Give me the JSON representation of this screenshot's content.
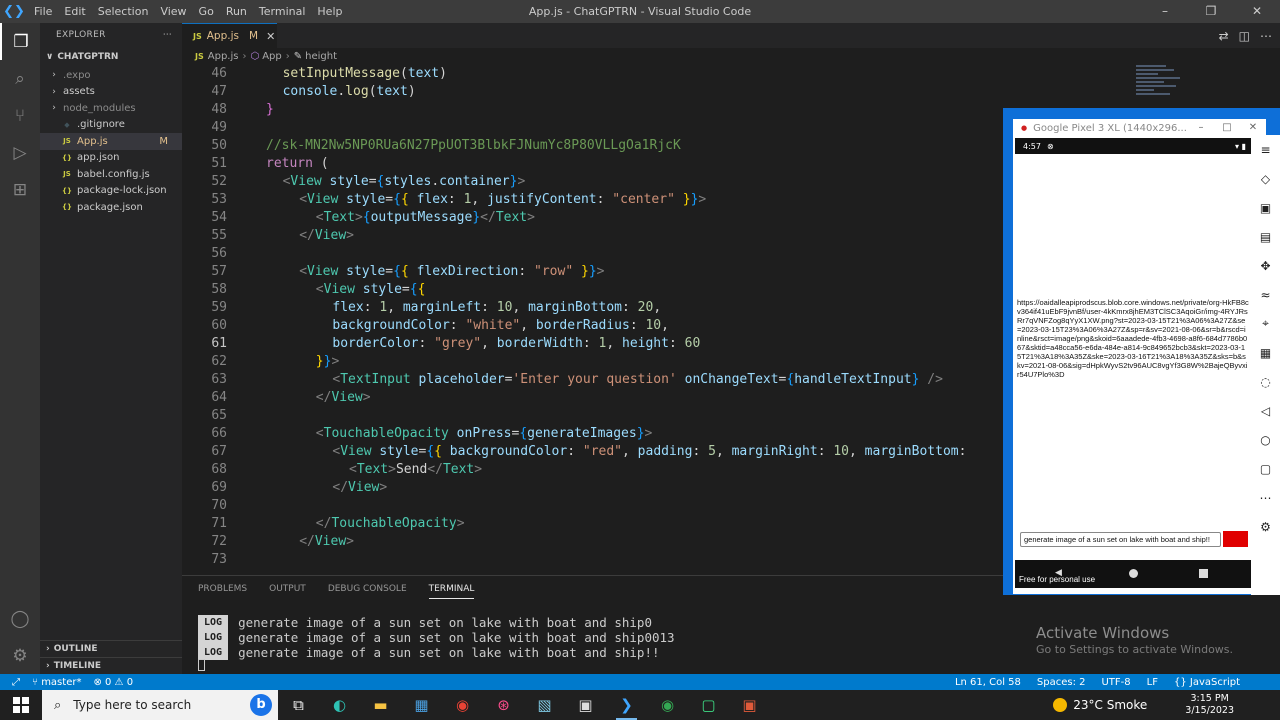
{
  "window": {
    "title": "App.js - ChatGPTRN - Visual Studio Code",
    "menu": [
      "File",
      "Edit",
      "Selection",
      "View",
      "Go",
      "Run",
      "Terminal",
      "Help"
    ]
  },
  "sidebar": {
    "header": "EXPLORER",
    "folder": "CHATGPTRN",
    "items": [
      {
        "label": ".expo",
        "type": "folder",
        "dim": true
      },
      {
        "label": "assets",
        "type": "folder",
        "dim": false
      },
      {
        "label": "node_modules",
        "type": "folder",
        "dim": true
      },
      {
        "label": ".gitignore",
        "type": "git",
        "dim": false
      },
      {
        "label": "App.js",
        "type": "js",
        "badge": "M"
      },
      {
        "label": "app.json",
        "type": "json"
      },
      {
        "label": "babel.config.js",
        "type": "js"
      },
      {
        "label": "package-lock.json",
        "type": "json"
      },
      {
        "label": "package.json",
        "type": "json"
      }
    ],
    "outline": "OUTLINE",
    "timeline": "TIMELINE"
  },
  "tabs": [
    {
      "label": "App.js",
      "badge": "M"
    }
  ],
  "breadcrumbs": [
    "App.js",
    "App",
    "height"
  ],
  "code_lines": [
    {
      "n": "46",
      "tokens": [
        [
          "fn",
          "setInputMessage"
        ],
        [
          "p",
          "("
        ],
        [
          "var",
          "text"
        ],
        [
          "p",
          ")"
        ]
      ]
    },
    {
      "n": "47",
      "tokens": [
        [
          "var",
          "console"
        ],
        [
          "p",
          "."
        ],
        [
          "fn",
          "log"
        ],
        [
          "p",
          "("
        ],
        [
          "var",
          "text"
        ],
        [
          "p",
          ")"
        ]
      ]
    },
    {
      "n": "48",
      "tokens": [
        [
          "br2",
          "}"
        ]
      ]
    },
    {
      "n": "49",
      "tokens": []
    },
    {
      "n": "50",
      "tokens": [
        [
          "cm",
          "//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"
        ]
      ]
    },
    {
      "n": "51",
      "tokens": [
        [
          "kw",
          "return"
        ],
        [
          "p",
          " ("
        ]
      ]
    },
    {
      "n": "52",
      "tokens": [
        [
          "punc",
          "<"
        ],
        [
          "tag",
          "View"
        ],
        [
          "var",
          " style"
        ],
        [
          "p",
          "="
        ],
        [
          "br3",
          "{"
        ],
        [
          "var",
          "styles"
        ],
        [
          "p",
          "."
        ],
        [
          "var",
          "container"
        ],
        [
          "br3",
          "}"
        ],
        [
          "punc",
          ">"
        ]
      ]
    },
    {
      "n": "53",
      "tokens": [
        [
          "punc",
          "<"
        ],
        [
          "tag",
          "View"
        ],
        [
          "var",
          " style"
        ],
        [
          "p",
          "="
        ],
        [
          "br3",
          "{"
        ],
        [
          "br",
          "{"
        ],
        [
          "var",
          " flex"
        ],
        [
          "p",
          ": "
        ],
        [
          "num",
          "1"
        ],
        [
          "p",
          ", "
        ],
        [
          "var",
          "justifyContent"
        ],
        [
          "p",
          ": "
        ],
        [
          "str",
          "\"center\""
        ],
        [
          "p",
          " "
        ],
        [
          "br",
          "}"
        ],
        [
          "br3",
          "}"
        ],
        [
          "punc",
          ">"
        ]
      ]
    },
    {
      "n": "54",
      "tokens": [
        [
          "punc",
          "<"
        ],
        [
          "tag",
          "Text"
        ],
        [
          "punc",
          ">"
        ],
        [
          "br3",
          "{"
        ],
        [
          "var",
          "outputMessage"
        ],
        [
          "br3",
          "}"
        ],
        [
          "punc",
          "</"
        ],
        [
          "tag",
          "Text"
        ],
        [
          "punc",
          ">"
        ]
      ]
    },
    {
      "n": "55",
      "tokens": [
        [
          "punc",
          "</"
        ],
        [
          "tag",
          "View"
        ],
        [
          "punc",
          ">"
        ]
      ]
    },
    {
      "n": "56",
      "tokens": []
    },
    {
      "n": "57",
      "tokens": [
        [
          "punc",
          "<"
        ],
        [
          "tag",
          "View"
        ],
        [
          "var",
          " style"
        ],
        [
          "p",
          "="
        ],
        [
          "br3",
          "{"
        ],
        [
          "br",
          "{"
        ],
        [
          "var",
          " flexDirection"
        ],
        [
          "p",
          ": "
        ],
        [
          "str",
          "\"row\""
        ],
        [
          "p",
          " "
        ],
        [
          "br",
          "}"
        ],
        [
          "br3",
          "}"
        ],
        [
          "punc",
          ">"
        ]
      ]
    },
    {
      "n": "58",
      "tokens": [
        [
          "punc",
          "<"
        ],
        [
          "tag",
          "View"
        ],
        [
          "var",
          " style"
        ],
        [
          "p",
          "="
        ],
        [
          "br3",
          "{"
        ],
        [
          "br",
          "{"
        ]
      ]
    },
    {
      "n": "59",
      "tokens": [
        [
          "var",
          "flex"
        ],
        [
          "p",
          ": "
        ],
        [
          "num",
          "1"
        ],
        [
          "p",
          ", "
        ],
        [
          "var",
          "marginLeft"
        ],
        [
          "p",
          ": "
        ],
        [
          "num",
          "10"
        ],
        [
          "p",
          ", "
        ],
        [
          "var",
          "marginBottom"
        ],
        [
          "p",
          ": "
        ],
        [
          "num",
          "20"
        ],
        [
          "p",
          ","
        ]
      ]
    },
    {
      "n": "60",
      "tokens": [
        [
          "var",
          "backgroundColor"
        ],
        [
          "p",
          ": "
        ],
        [
          "str",
          "\"white\""
        ],
        [
          "p",
          ", "
        ],
        [
          "var",
          "borderRadius"
        ],
        [
          "p",
          ": "
        ],
        [
          "num",
          "10"
        ],
        [
          "p",
          ","
        ]
      ]
    },
    {
      "n": "61",
      "tokens": [
        [
          "var",
          "borderColor"
        ],
        [
          "p",
          ": "
        ],
        [
          "str",
          "\"grey\""
        ],
        [
          "p",
          ", "
        ],
        [
          "var",
          "borderWidth"
        ],
        [
          "p",
          ": "
        ],
        [
          "num",
          "1"
        ],
        [
          "p",
          ", "
        ],
        [
          "var",
          "height"
        ],
        [
          "p",
          ": "
        ],
        [
          "num",
          "60"
        ]
      ]
    },
    {
      "n": "62",
      "tokens": [
        [
          "br",
          "}"
        ],
        [
          "br3",
          "}"
        ],
        [
          "punc",
          ">"
        ]
      ]
    },
    {
      "n": "63",
      "tokens": [
        [
          "punc",
          "<"
        ],
        [
          "tag",
          "TextInput"
        ],
        [
          "var",
          " placeholder"
        ],
        [
          "p",
          "="
        ],
        [
          "str",
          "'Enter your question'"
        ],
        [
          "var",
          " onChangeText"
        ],
        [
          "p",
          "="
        ],
        [
          "br3",
          "{"
        ],
        [
          "var",
          "handleTextInput"
        ],
        [
          "br3",
          "}"
        ],
        [
          "punc",
          " />"
        ]
      ]
    },
    {
      "n": "64",
      "tokens": [
        [
          "punc",
          "</"
        ],
        [
          "tag",
          "View"
        ],
        [
          "punc",
          ">"
        ]
      ]
    },
    {
      "n": "65",
      "tokens": []
    },
    {
      "n": "66",
      "tokens": [
        [
          "punc",
          "<"
        ],
        [
          "tag",
          "TouchableOpacity"
        ],
        [
          "var",
          " onPress"
        ],
        [
          "p",
          "="
        ],
        [
          "br3",
          "{"
        ],
        [
          "var",
          "generateImages"
        ],
        [
          "br3",
          "}"
        ],
        [
          "punc",
          ">"
        ]
      ]
    },
    {
      "n": "67",
      "tokens": [
        [
          "punc",
          "<"
        ],
        [
          "tag",
          "View"
        ],
        [
          "var",
          " style"
        ],
        [
          "p",
          "="
        ],
        [
          "br3",
          "{"
        ],
        [
          "br",
          "{"
        ],
        [
          "var",
          " backgroundColor"
        ],
        [
          "p",
          ": "
        ],
        [
          "str",
          "\"red\""
        ],
        [
          "p",
          ", "
        ],
        [
          "var",
          "padding"
        ],
        [
          "p",
          ": "
        ],
        [
          "num",
          "5"
        ],
        [
          "p",
          ", "
        ],
        [
          "var",
          "marginRight"
        ],
        [
          "p",
          ": "
        ],
        [
          "num",
          "10"
        ],
        [
          "p",
          ", "
        ],
        [
          "var",
          "marginBottom"
        ],
        [
          "p",
          ":"
        ]
      ]
    },
    {
      "n": "68",
      "tokens": [
        [
          "punc",
          "<"
        ],
        [
          "tag",
          "Text"
        ],
        [
          "punc",
          ">"
        ],
        [
          "p",
          "Send"
        ],
        [
          "punc",
          "</"
        ],
        [
          "tag",
          "Text"
        ],
        [
          "punc",
          ">"
        ]
      ]
    },
    {
      "n": "69",
      "tokens": [
        [
          "punc",
          "</"
        ],
        [
          "tag",
          "View"
        ],
        [
          "punc",
          ">"
        ]
      ]
    },
    {
      "n": "70",
      "tokens": []
    },
    {
      "n": "71",
      "tokens": [
        [
          "punc",
          "</"
        ],
        [
          "tag",
          "TouchableOpacity"
        ],
        [
          "punc",
          ">"
        ]
      ]
    },
    {
      "n": "72",
      "tokens": [
        [
          "punc",
          "</"
        ],
        [
          "tag",
          "View"
        ],
        [
          "punc",
          ">"
        ]
      ]
    },
    {
      "n": "73",
      "tokens": []
    }
  ],
  "panel": {
    "tabs": [
      "PROBLEMS",
      "OUTPUT",
      "DEBUG CONSOLE",
      "TERMINAL"
    ],
    "active_tab": "TERMINAL",
    "badge": "LOG",
    "terminal_lines": [
      "generate image of a sun set on lake with boat and ship0",
      "generate image of a sun set on lake with boat and ship0013",
      "generate image of a sun set on lake with boat and ship!!"
    ]
  },
  "watermark": {
    "title": "Activate Windows",
    "subtitle": "Go to Settings to activate Windows."
  },
  "statusbar": {
    "branch": "master*",
    "problems": "⊗ 0 ⚠ 0",
    "position": "Ln 61, Col 58",
    "spaces": "Spaces: 2",
    "encoding": "UTF-8",
    "eol": "LF",
    "language": "{} JavaScript"
  },
  "emulator": {
    "title": "Google Pixel 3 XL (1440x296...",
    "time": "4:57",
    "url": "https://oaidalleapiprodscus.blob.core.windows.net/private/org-HkFB8cv364if41uEbF9jvnBf/user-4kKmrx8jhEM3TClSC3AqoiGr/img-4RYJRsRr7qVNFZog8qYyX1XW.png?st=2023-03-15T21%3A06%3A27Z&se=2023-03-15T23%3A06%3A27Z&sp=r&sv=2021-08-06&sr=b&rscd=inline&rsct=image/png&skoid=6aaadede-4fb3-4698-a8f6-684d7786b067&sktid=a48cca56-e6da-484e-a814-9c849652bcb3&skt=2023-03-15T21%3A18%3A35Z&ske=2023-03-16T21%3A18%3A35Z&sks=b&skv=2021-08-06&sig=dHpkWyvS2tv96AUC8vgYf3G8W%2BajeQByvxir54U7Plo%3D",
    "input_value": "generate image of a sun set on lake with boat and ship!!",
    "free_use": "Free for personal use"
  },
  "taskbar": {
    "search_placeholder": "Type here to search",
    "weather": "23°C Smoke",
    "time": "3:15 PM",
    "date": "3/15/2023"
  }
}
